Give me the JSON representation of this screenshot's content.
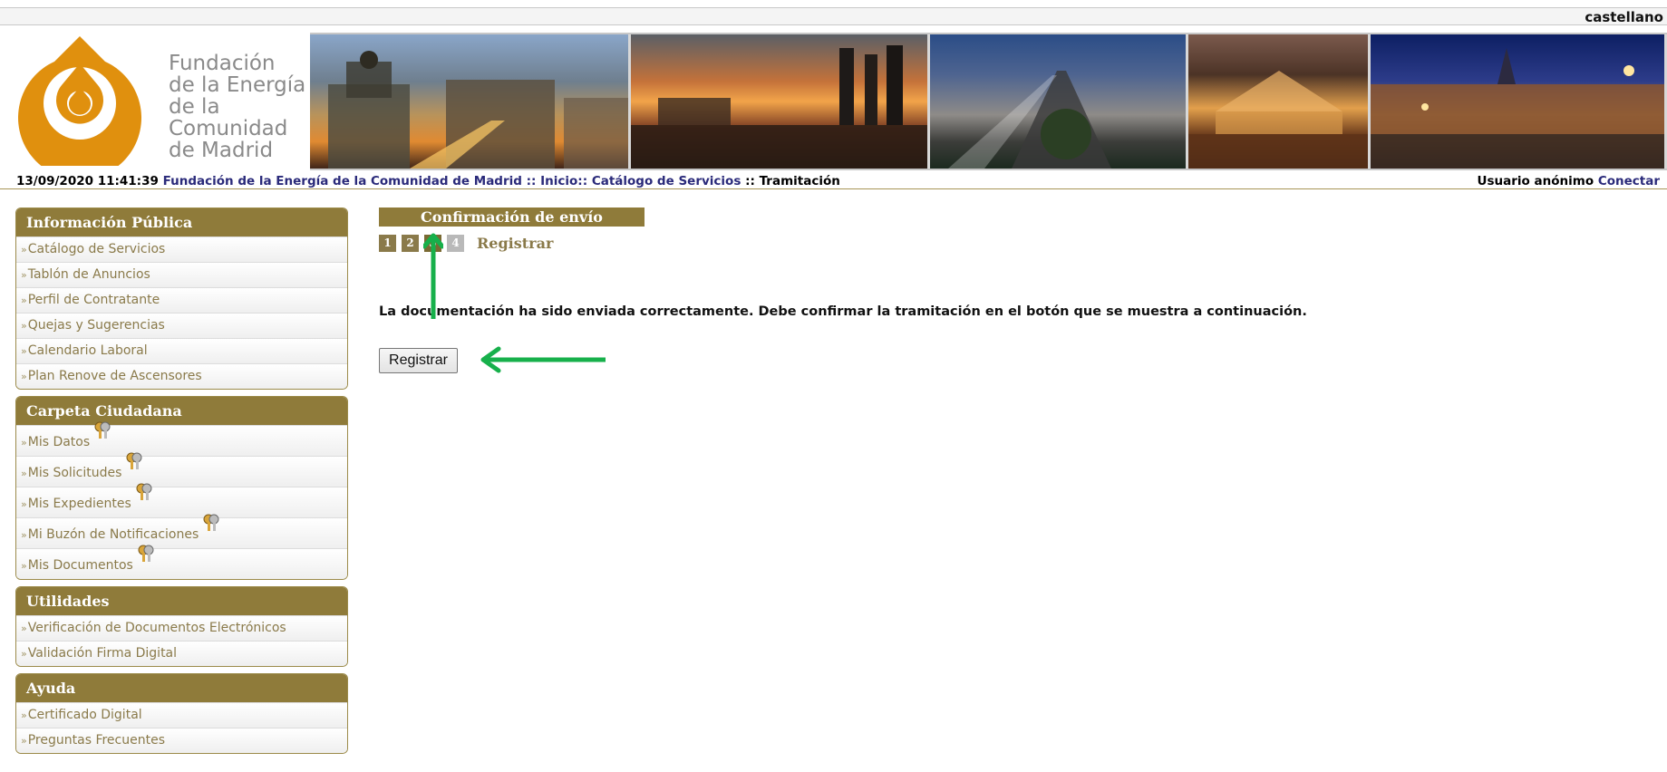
{
  "header": {
    "language": "castellano",
    "logo_lines": [
      "Fundación",
      "de la Energía",
      "de la",
      "Comunidad",
      "de Madrid"
    ]
  },
  "breadcrumb": {
    "datetime": "13/09/2020 11:41:39",
    "org_link": "Fundación de la Energía de la Comunidad de Madrid",
    "sep1": "::",
    "home_link": "Inicio::",
    "catalog_link": "Catálogo de Servicios",
    "sep2": "::",
    "current": "Tramitación",
    "user_label": "Usuario anónimo",
    "connect_link": "Conectar"
  },
  "sidebar": {
    "panels": [
      {
        "title": "Información Pública",
        "items": [
          "Catálogo de Servicios",
          "Tablón de Anuncios",
          "Perfil de Contratante",
          "Quejas y Sugerencias",
          "Calendario Laboral",
          "Plan Renove de Ascensores"
        ]
      },
      {
        "title": "Carpeta Ciudadana",
        "items": [
          "Mis Datos",
          "Mis Solicitudes",
          "Mis Expedientes",
          "Mi Buzón de Notificaciones",
          "Mis Documentos"
        ]
      },
      {
        "title": "Utilidades",
        "items": [
          "Verificación de Documentos Electrónicos",
          "Validación Firma Digital"
        ]
      },
      {
        "title": "Ayuda",
        "items": [
          "Certificado Digital",
          "Preguntas Frecuentes"
        ]
      }
    ]
  },
  "main": {
    "title": "Confirmación de envío",
    "steps": [
      "1",
      "2",
      "3",
      "4"
    ],
    "current_step": 3,
    "step_label": "Registrar",
    "message": "La documentación ha sido enviada correctamente. Debe confirmar la tramitación en el botón que se muestra a continuación.",
    "button_label": "Registrar"
  },
  "colors": {
    "brand": "#8f7b3a",
    "logo_orange": "#e0900e",
    "annotation_arrow": "#17b04b",
    "link": "#2a2a7a"
  }
}
